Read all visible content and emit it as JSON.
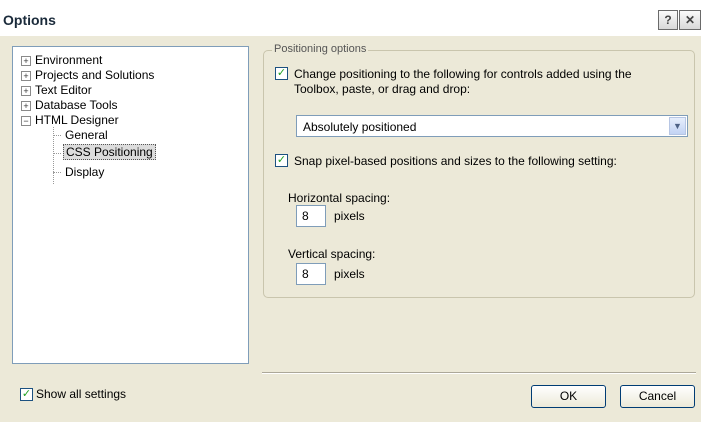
{
  "window": {
    "title": "Options",
    "help_glyph": "?",
    "close_glyph": "✕"
  },
  "tree": {
    "items": [
      {
        "label": "Environment",
        "expander": "+"
      },
      {
        "label": "Projects and Solutions",
        "expander": "+"
      },
      {
        "label": "Text Editor",
        "expander": "+"
      },
      {
        "label": "Database Tools",
        "expander": "+"
      },
      {
        "label": "HTML Designer",
        "expander": "−"
      }
    ],
    "children": [
      {
        "label": "General"
      },
      {
        "label": "CSS Positioning"
      },
      {
        "label": "Display"
      }
    ]
  },
  "positioning": {
    "legend": "Positioning options",
    "change_check_line1": "Change positioning to the following for controls added using the",
    "change_check_line2": "Toolbox, paste, or drag and drop:",
    "change_checked": "✓",
    "dropdown_value": "Absolutely positioned",
    "dropdown_arrow": "▼",
    "snap_label": "Snap pixel-based positions and sizes to the following setting:",
    "snap_checked": "✓",
    "horizontal_label": "Horizontal spacing:",
    "horizontal_value": "8",
    "horizontal_unit": "pixels",
    "vertical_label": "Vertical spacing:",
    "vertical_value": "8",
    "vertical_unit": "pixels"
  },
  "footer": {
    "show_all_label": "Show all settings",
    "show_all_checked": "✓",
    "ok_label": "OK",
    "cancel_label": "Cancel"
  }
}
